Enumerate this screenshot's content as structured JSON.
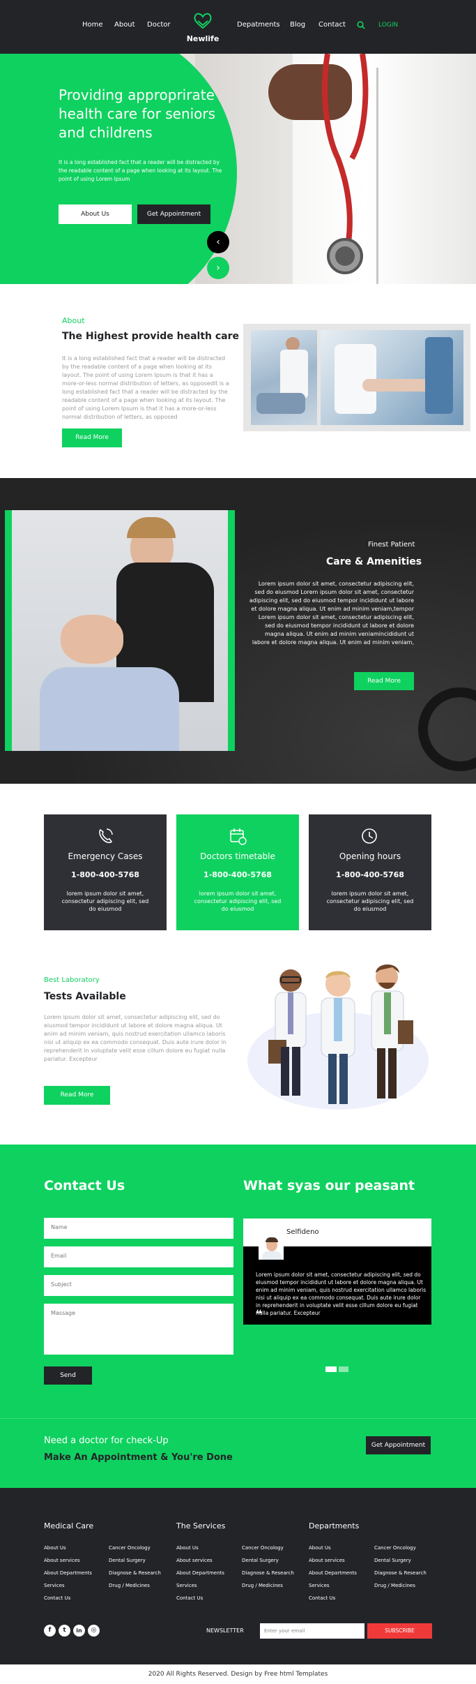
{
  "header": {
    "nav_left": [
      "Home",
      "About",
      "Doctor"
    ],
    "nav_right": [
      "Depatments",
      "Blog",
      "Contact"
    ],
    "logo": "Newlife",
    "login": "LOGIN"
  },
  "hero": {
    "title": "Providing approprirate health care for seniors and childrens",
    "text": "It is a long established fact that a reader will be distracted by the readable content of a page when looking at its layout. The point of using Lorem Ipsum",
    "btn_about": "About Us",
    "btn_appointment": "Get Appointment",
    "prev": "‹",
    "next": "›"
  },
  "about": {
    "label": "About",
    "title": "The Highest provide health care",
    "text": "It is a long established fact that a reader will be distracted by the readable content of a page when looking at its layout. The point of using Lorem Ipsum is that it has a more-or-less normal distribution of letters, as opposedit is a long established fact that a reader will be distracted by the readable content of a page when looking at its layout. The point of using Lorem Ipsum is that it has a more-or-less normal distribution of letters, as opposed",
    "btn": "Read More"
  },
  "care": {
    "label": "Finest Patient",
    "title": "Care & Amenities",
    "text": "Lorem ipsum dolor sit amet, consectetur adipiscing elit, sed do eiusmod Lorem ipsum dolor sit amet, consectetur adipiscing elit, sed do eiusmod tempor incididunt ut labore et dolore magna aliqua. Ut enim ad minim veniam,tempor Lorem ipsum dolor sit amet, consectetur adipiscing elit, sed do eiusmod tempor incididunt ut labore et dolore magna aliqua. Ut enim ad minim veniamincididunt ut labore et dolore magna aliqua. Ut enim ad minim veniam,",
    "btn": "Read More"
  },
  "cards": [
    {
      "title": "Emergency Cases",
      "phone": "1-800-400-5768",
      "text": "lorem ipsum dolor sit amet, consectetur adipiscing elit, sed do eiusmod",
      "icon": "phone-icon"
    },
    {
      "title": "Doctors timetable",
      "phone": "1-800-400-5768",
      "text": "lorem ipsum dolor sit amet, consectetur adipiscing elit, sed do eiusmod",
      "icon": "calendar-icon"
    },
    {
      "title": "Opening hours",
      "phone": "1-800-400-5768",
      "text": "lorem ipsum dolor sit amet, consectetur adipiscing elit, sed do eiusmod",
      "icon": "clock-icon"
    }
  ],
  "lab": {
    "label": "Best Laboratory",
    "title": "Tests Available",
    "text": "Lorem ipsum dolor sit amet, consectetur adipiscing elit, sed do eiusmod tempor incididunt ut labore et dolore magna aliqua. Ut enim ad minim veniam, quis nostrud exercitation ullamco laboris nisi ut aliquip ex ea commodo consequat. Duis aute irure dolor in reprehenderit in voluptate velit esse cillum dolore eu fugiat nulla pariatur. Excepteur",
    "btn": "Read More"
  },
  "contact": {
    "title": "Contact Us",
    "name_ph": "Name",
    "email_ph": "Email",
    "subject_ph": "Subject",
    "message_ph": "Massage",
    "send": "Send"
  },
  "testimonial": {
    "title": "What syas our peasant",
    "name": "Selfideno",
    "text": "Lorem ipsum dolor sit amet, consectetur adipiscing elit, sed do eiusmod tempor incididunt ut labore et dolore magna aliqua. Ut enim ad minim veniam, quis nostrud exercitation ullamco laboris nisi ut aliquip ex ea commodo consequat. Duis aute irure dolor in reprehenderit in voluptate velit esse cillum dolore eu fugiat nulla pariatur. Excepteur",
    "quote": "❝"
  },
  "appointment": {
    "line1": "Need a doctor for check-Up",
    "line2": "Make An Appointment & You're Done",
    "btn": "Get Appointment"
  },
  "footer": {
    "col1_title": "Medical Care",
    "col2_title": "The Services",
    "col3_title": "Departments",
    "links_a": [
      "About Us",
      "About services",
      "About Departments",
      "Services",
      "Contact Us"
    ],
    "links_b": [
      "Cancer Oncology",
      "Dental Surgery",
      "Diagnose & Research",
      "Drug / Medicines"
    ],
    "social": [
      "f",
      "t",
      "in",
      "◎"
    ],
    "newsletter_label": "NEWSLETTER",
    "newsletter_ph": "Enter your email",
    "subscribe": "SUBSCRIBE"
  },
  "copyright": "2020 All Rights Reserved. Design by Free html Templates",
  "colors": {
    "green": "#0fd15f",
    "dark": "#232428",
    "red": "#f03a3a"
  }
}
